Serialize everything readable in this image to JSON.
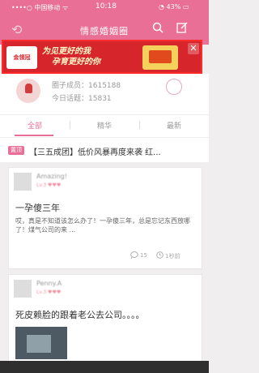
{
  "status": {
    "carrier": "••••○ 中国移动 ᯤ",
    "time": "10:18",
    "battery": "◔ 43% ▭"
  },
  "header": {
    "title": "情感婚姻圈"
  },
  "ad": {
    "logo_text": "金领冠",
    "slogan_line1": "为见更好的我",
    "slogan_line2": "孕育更好的你",
    "close": "✕"
  },
  "group": {
    "members_label": "圈子成员：",
    "members_count": "1615188",
    "topics_label": "今日话题：",
    "topics_count": "15831"
  },
  "tabs": [
    "全部",
    "精华",
    "最新"
  ],
  "notice": {
    "badge": "置顶",
    "text": "【三五成团】低价风暴再度来袭 红..."
  },
  "posts": [
    {
      "username": "Amazing!",
      "level": "Lv.3 ♥♥♥",
      "title": "一孕傻三年",
      "summary": "哎，真是不知道该怎么办了！一孕傻三年，总是忘记东西放哪了！煤气公司的来 ...",
      "comments": "15",
      "time": "1秒前"
    },
    {
      "username": "Penny.A",
      "level": "Lv.3 ♥♥♥",
      "title": "死皮赖脸的跟着老公去公司。。。。"
    }
  ]
}
